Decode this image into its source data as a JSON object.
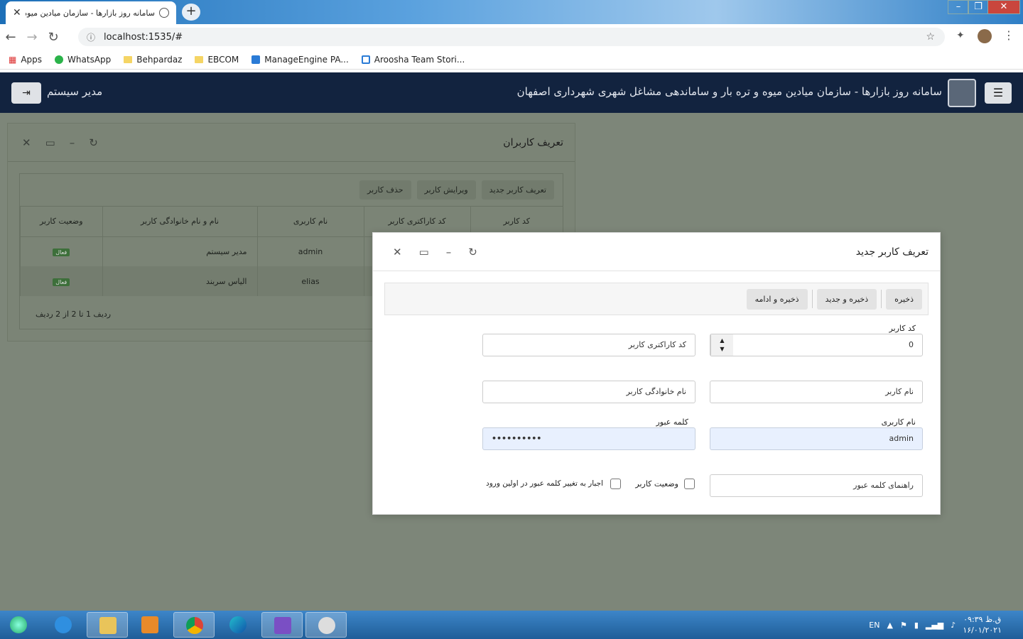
{
  "browser": {
    "tab_title": "سامانه روز بازارها - سازمان میادین میوه و",
    "url": "localhost:1535/#",
    "bookmarks": [
      "Apps",
      "WhatsApp",
      "Behpardaz",
      "EBCOM",
      "ManageEngine PA...",
      "Aroosha Team Stori..."
    ]
  },
  "header": {
    "title": "سامانه روز بازارها - سازمان میادین میوه و تره بار و ساماندهی مشاغل شهری شهرداری اصفهان",
    "user": "مدیر سیستم"
  },
  "users_window": {
    "title": "تعریف کاربران",
    "toolbar": [
      "تعریف کاربر جدید",
      "ویرایش کاربر",
      "حذف کاربر"
    ],
    "columns": [
      "کد کاربر",
      "کد کاراکتری کاربر",
      "نام کاربری",
      "نام و نام خانوادگی کاربر",
      "وضعیت کاربر"
    ],
    "rows": [
      {
        "username": "admin",
        "fullname": "مدیر سیستم",
        "status": "فعال"
      },
      {
        "username": "elias",
        "fullname": "الیاس سربند",
        "status": "فعال"
      }
    ],
    "pager": "ردیف 1 تا 2 از 2 ردیف"
  },
  "dialog": {
    "title": "تعریف کاربر جدید",
    "buttons": {
      "save": "ذخیره",
      "save_new": "ذخیره و جدید",
      "save_continue": "ذخیره و ادامه"
    },
    "user_code_label": "کد کاربر",
    "user_code_value": "0",
    "char_code_placeholder": "کد کاراکتری کاربر",
    "first_name_placeholder": "نام کاربر",
    "last_name_placeholder": "نام خانوادگی کاربر",
    "username_label": "نام کاربری",
    "username_value": "admin",
    "password_label": "کلمه عبور",
    "password_value": "••••••••••",
    "hint_placeholder": "راهنمای کلمه عبور",
    "status_label": "وضعیت کاربر",
    "force_change_label": "اجبار به تغییر کلمه عبور در اولین ورود"
  },
  "taskbar": {
    "lang": "EN",
    "time": "ق.ظ ۰۹:۳۹",
    "date": "۱۶/۰۱/۲۰۲۱"
  }
}
